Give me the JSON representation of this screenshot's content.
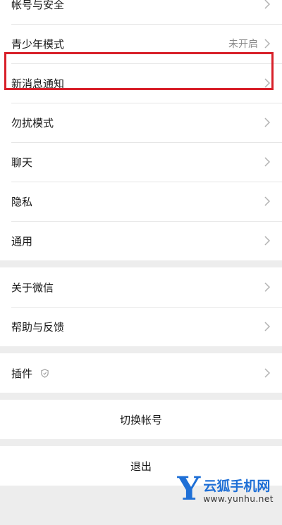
{
  "settings": {
    "group1": [
      {
        "label": "帐号与安全",
        "value": ""
      },
      {
        "label": "青少年模式",
        "value": "未开启"
      },
      {
        "label": "新消息通知",
        "value": ""
      },
      {
        "label": "勿扰模式",
        "value": ""
      },
      {
        "label": "聊天",
        "value": ""
      },
      {
        "label": "隐私",
        "value": ""
      },
      {
        "label": "通用",
        "value": ""
      }
    ],
    "group2": [
      {
        "label": "关于微信"
      },
      {
        "label": "帮助与反馈"
      }
    ],
    "group3": [
      {
        "label": "插件"
      }
    ]
  },
  "actions": {
    "switch_account": "切换帐号",
    "logout": "退出"
  },
  "watermark": {
    "logo_letter": "Y",
    "name": "云狐手机网",
    "url": "www.yunhu.net"
  },
  "colors": {
    "highlight": "#d8202a",
    "watermark": "#1e6fd6"
  }
}
